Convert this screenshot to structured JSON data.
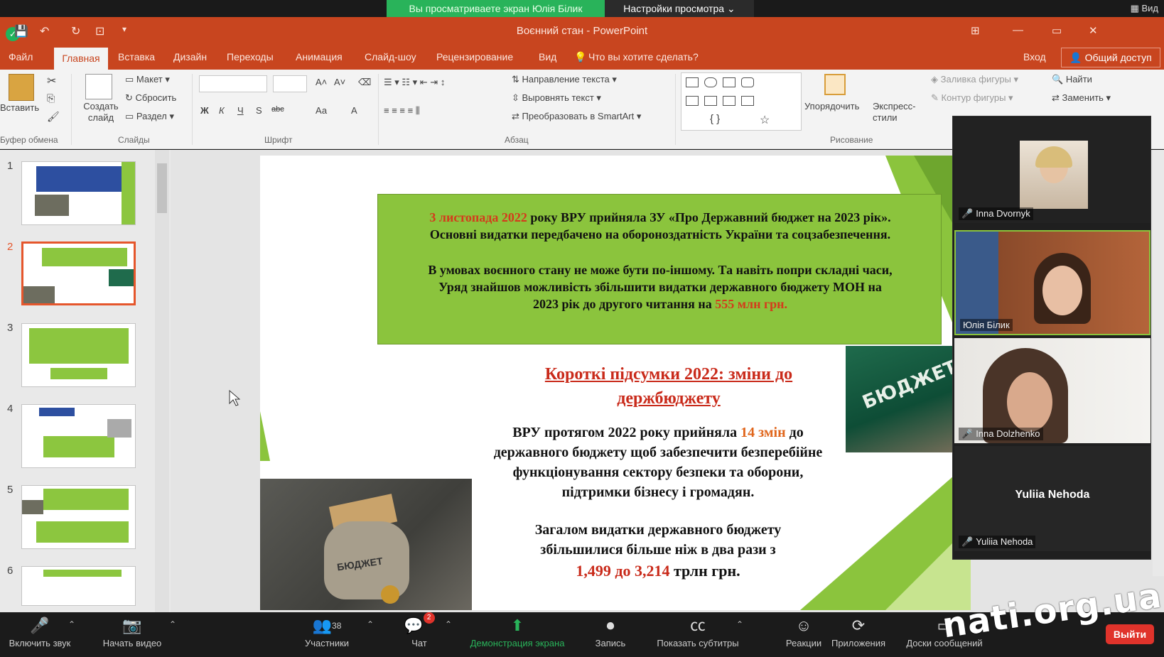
{
  "zoom": {
    "share_banner": "Вы просматриваете экран Юлія Білик",
    "view_settings": "Настройки просмотра ⌄",
    "view": "Вид"
  },
  "ppt": {
    "title": "Воєнний стан - PowerPoint",
    "tabs": [
      "Файл",
      "Главная",
      "Вставка",
      "Дизайн",
      "Переходы",
      "Анимация",
      "Слайд-шоу",
      "Рецензирование",
      "Вид"
    ],
    "tell_me": "Что вы хотите сделать?",
    "signin": "Вход",
    "share": "Общий доступ"
  },
  "ribbon": {
    "paste": "Вставить",
    "clipboard": "Буфер обмена",
    "new_slide": "Создать слайд",
    "layout": "Макет",
    "reset": "Сбросить",
    "section": "Раздел",
    "slides": "Слайды",
    "font_group": "Шрифт",
    "text_direction": "Направление текста",
    "align_text": "Выровнять текст",
    "smartart": "Преобразовать в SmartArt",
    "paragraph": "Абзац",
    "arrange": "Упорядочить",
    "quick_styles": "Экспресс-стили",
    "drawing": "Рисование",
    "shape_fill": "Заливка фигуры",
    "shape_outline": "Контур фигуры",
    "find": "Найти",
    "replace": "Заменить",
    "font_buttons": [
      "Ж",
      "К",
      "Ч",
      "S",
      "abc",
      "Аа",
      "А"
    ]
  },
  "thumbnails": [
    "1",
    "2",
    "3",
    "4",
    "5",
    "6"
  ],
  "slide": {
    "box_l1_red": "3 листопада 2022",
    "box_l1_rest": " року ВРУ прийняла ЗУ «Про Державний бюджет на 2023 рік».",
    "box_l2": "Основні видатки передбачено на обороноздатність України та соцзабезпечення.",
    "box_l3": "В умовах воєнного стану не може бути по-іншому. Та навіть попри складні часи,",
    "box_l4": "Уряд знайшов можливість збільшити видатки державного бюджету МОН на",
    "box_l5_pre": "2023 рік до другого читання на ",
    "box_l5_red": "555 млн грн.",
    "subtitle": "Короткі підсумки 2022: зміни до держбюджету",
    "p1_pre": "ВРУ протягом 2022 року прийняла ",
    "p1_red": "14 змін",
    "p1_post": " до",
    "p2": "державного бюджету щоб забезпечити безперебійне",
    "p3": "функціонування сектору безпеки та оборони,",
    "p4": "підтримки бізнесу і громадян.",
    "p5": "Загалом видатки державного бюджету",
    "p6": "збільшилися більше ніж в два рази з",
    "p7_red": "1,499 до 3,214",
    "p7_post": " трлн грн.",
    "bag_label": "БЮДЖЕТ",
    "book_label": "БЮДЖЕТ"
  },
  "participants": [
    {
      "name": "Inna Dvornyk"
    },
    {
      "name": "Юлія Білик"
    },
    {
      "name": "Inna Dolzhenko"
    },
    {
      "name": "Yuliia Nehoda",
      "center": "Yuliia Nehoda"
    }
  ],
  "toolbar": {
    "mic": "Включить звук",
    "video": "Начать видео",
    "participants": "Участники",
    "participants_count": "38",
    "chat": "Чат",
    "chat_badge": "2",
    "share": "Демонстрация экрана",
    "record": "Запись",
    "captions": "Показать субтитры",
    "reactions": "Реакции",
    "apps": "Приложения",
    "whiteboards": "Доски сообщений",
    "leave": "Выйти"
  },
  "watermark": "nati.org.ua",
  "colors": {
    "ppt_accent": "#c8451f",
    "slide_green": "#8bc43d",
    "red_text": "#d43b1c",
    "zoom_green": "#29b35a",
    "leave": "#e0332b"
  }
}
